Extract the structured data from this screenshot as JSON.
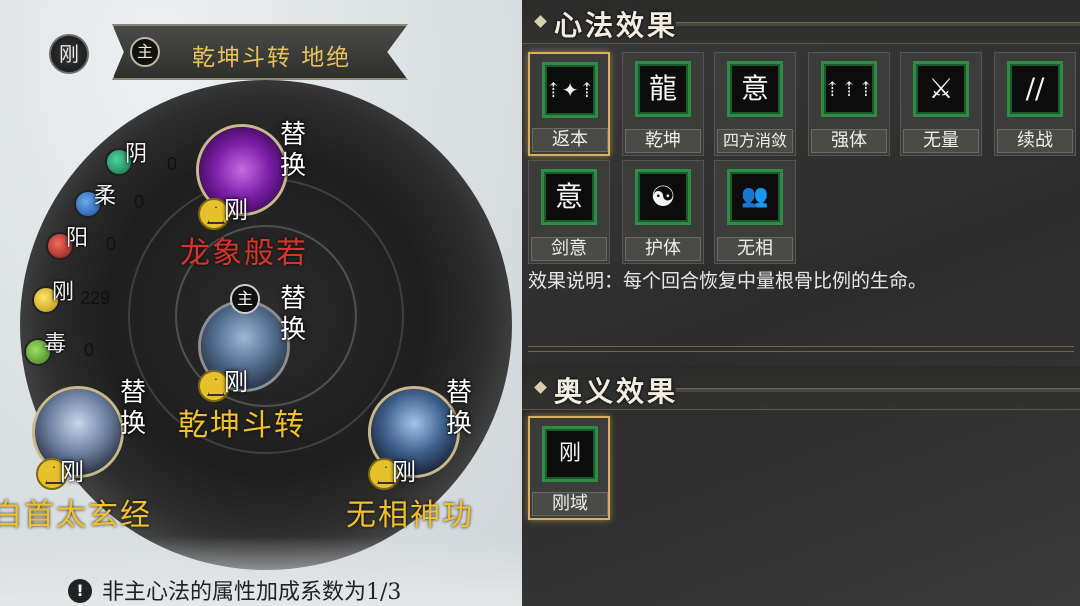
{
  "header": {
    "gang_label": "刚",
    "zhu_label": "主",
    "title": "乾坤斗转 地绝"
  },
  "attributes": [
    {
      "label": "阴",
      "value": "0",
      "color": "#1f8a5a"
    },
    {
      "label": "柔",
      "value": "0",
      "color": "#2b6fc6"
    },
    {
      "label": "阳",
      "value": "0",
      "color": "#c6302b"
    },
    {
      "label": "刚",
      "value": "229",
      "color": "#e0b624"
    },
    {
      "label": "毒",
      "value": "0",
      "color": "#5aa02e"
    }
  ],
  "skills": {
    "top": {
      "name": "龙象般若",
      "swap": "替换",
      "gang": "刚",
      "name_color": "#d8332a"
    },
    "center": {
      "name": "乾坤斗转",
      "swap": "替换",
      "gang": "刚",
      "zhu": "主",
      "name_color": "#f0c12c"
    },
    "left": {
      "name": "白首太玄经",
      "swap": "替换",
      "gang": "刚",
      "name_color": "#f0c12c"
    },
    "right": {
      "name": "无相神功",
      "swap": "替换",
      "gang": "刚",
      "name_color": "#f0c12c"
    }
  },
  "footer_note": "非主心法的属性加成系数为1/3",
  "footer_icon": "!",
  "xinfa": {
    "title": "心法效果",
    "cards": [
      {
        "label": "返本",
        "icon": "figure-arrows-icon",
        "selected": true
      },
      {
        "label": "乾坤",
        "icon": "dragon-icon",
        "selected": false
      },
      {
        "label": "四方消敛",
        "icon": "yi-glyph-icon",
        "selected": false
      },
      {
        "label": "强体",
        "icon": "figure-up-arrows-icon",
        "selected": false
      },
      {
        "label": "无量",
        "icon": "blade-burst-icon",
        "selected": false
      },
      {
        "label": "续战",
        "icon": "twin-swords-icon",
        "selected": false
      },
      {
        "label": "剑意",
        "icon": "yi-sword-icon",
        "selected": false
      },
      {
        "label": "护体",
        "icon": "meditation-icon",
        "selected": false
      },
      {
        "label": "无相",
        "icon": "two-figures-icon",
        "selected": false
      }
    ],
    "glyphs": [
      "⇡✦⇡",
      "龍",
      "意",
      "⇡⇡⇡",
      "⚔",
      "//",
      "意",
      "☯",
      "👥"
    ],
    "description": "效果说明：每个回合恢复中量根骨比例的生命。"
  },
  "aoyi": {
    "title": "奥义效果",
    "cards": [
      {
        "label": "刚域",
        "icon": "gang-burst-icon",
        "selected": true,
        "glyph": "刚"
      }
    ]
  }
}
